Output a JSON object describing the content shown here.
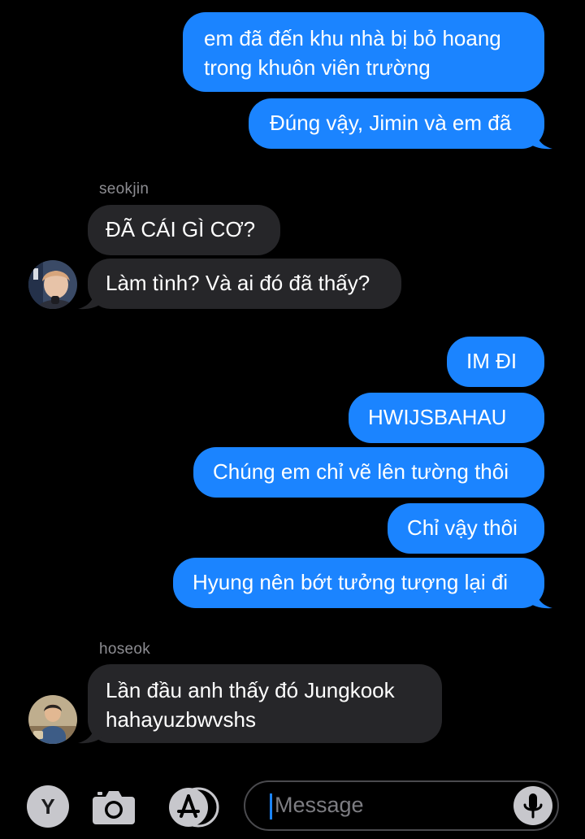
{
  "conversation": [
    {
      "type": "outgoing",
      "text": "em đã đến khu nhà bị bỏ hoang trong khuôn viên trường"
    },
    {
      "type": "outgoing",
      "text": "Đúng vậy, Jimin và em đã"
    },
    {
      "type": "sender",
      "name": "seokjin"
    },
    {
      "type": "incoming",
      "text": "ĐÃ CÁI GÌ CƠ?"
    },
    {
      "type": "incoming",
      "text": "Làm tình? Và ai đó đã thấy?"
    },
    {
      "type": "outgoing",
      "text": "IM ĐI"
    },
    {
      "type": "outgoing",
      "text": "HWIJSBAHAU"
    },
    {
      "type": "outgoing",
      "text": "Chúng em chỉ vẽ lên tường thôi"
    },
    {
      "type": "outgoing",
      "text": "Chỉ vậy thôi"
    },
    {
      "type": "outgoing",
      "text": "Hyung nên bớt tưởng tượng lại đi"
    },
    {
      "type": "sender",
      "name": "hoseok"
    },
    {
      "type": "incoming",
      "text": "Lần đầu anh thấy đó Jungkook hahayuzbwvshs"
    }
  ],
  "messages": {
    "m1_line1": "em đã đến khu nhà bị bỏ hoang",
    "m1_line2": "trong khuôn viên trường",
    "m2": "Đúng vậy, Jimin và em đã",
    "sender1": "seokjin",
    "m3": "ĐÃ CÁI GÌ CƠ?",
    "m4": "Làm tình? Và ai đó đã thấy?",
    "m5": "IM ĐI",
    "m6": "HWIJSBAHAU",
    "m7": "Chúng em chỉ vẽ lên tường thôi",
    "m8": "Chỉ vậy thôi",
    "m9": "Hyung nên bớt tưởng tượng lại đi",
    "sender2": "hoseok",
    "m10_line1": "Lần đầu anh thấy đó Jungkook",
    "m10_line2": "hahayuzbwvshs"
  },
  "input_bar": {
    "app_letter": "Y",
    "placeholder": "Message",
    "icons": [
      "camera-icon",
      "app-store-icon",
      "microphone-icon"
    ]
  },
  "colors": {
    "outgoing_bubble": "#1b84ff",
    "incoming_bubble": "#262629",
    "background": "#000000",
    "sender_name": "#8d8d92"
  }
}
